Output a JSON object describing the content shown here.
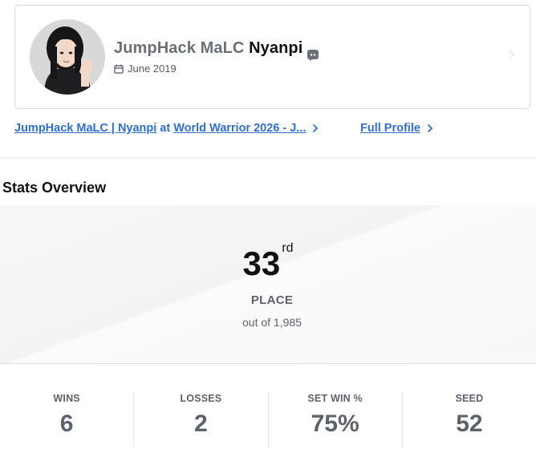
{
  "profile": {
    "prefix": "JumpHack MaLC",
    "gamer_tag": "Nyanpi",
    "join_date": "June 2019",
    "discord_icon": "discord-icon",
    "calendar_icon": "calendar-icon"
  },
  "links": {
    "event_team": "JumpHack MaLC | Nyanpi",
    "event_at": "at",
    "event_name": "World Warrior 2026 - J...",
    "full_profile": "Full Profile"
  },
  "stats_overview": {
    "title": "Stats Overview",
    "place_number": "33",
    "place_suffix": "rd",
    "place_label": "PLACE",
    "place_sub": "out of 1,985",
    "items": [
      {
        "label": "WINS",
        "value": "6"
      },
      {
        "label": "LOSSES",
        "value": "2"
      },
      {
        "label": "SET WIN %",
        "value": "75%"
      },
      {
        "label": "SEED",
        "value": "52"
      }
    ]
  },
  "colors": {
    "link": "#2f6fd1",
    "muted": "#5e636b"
  }
}
